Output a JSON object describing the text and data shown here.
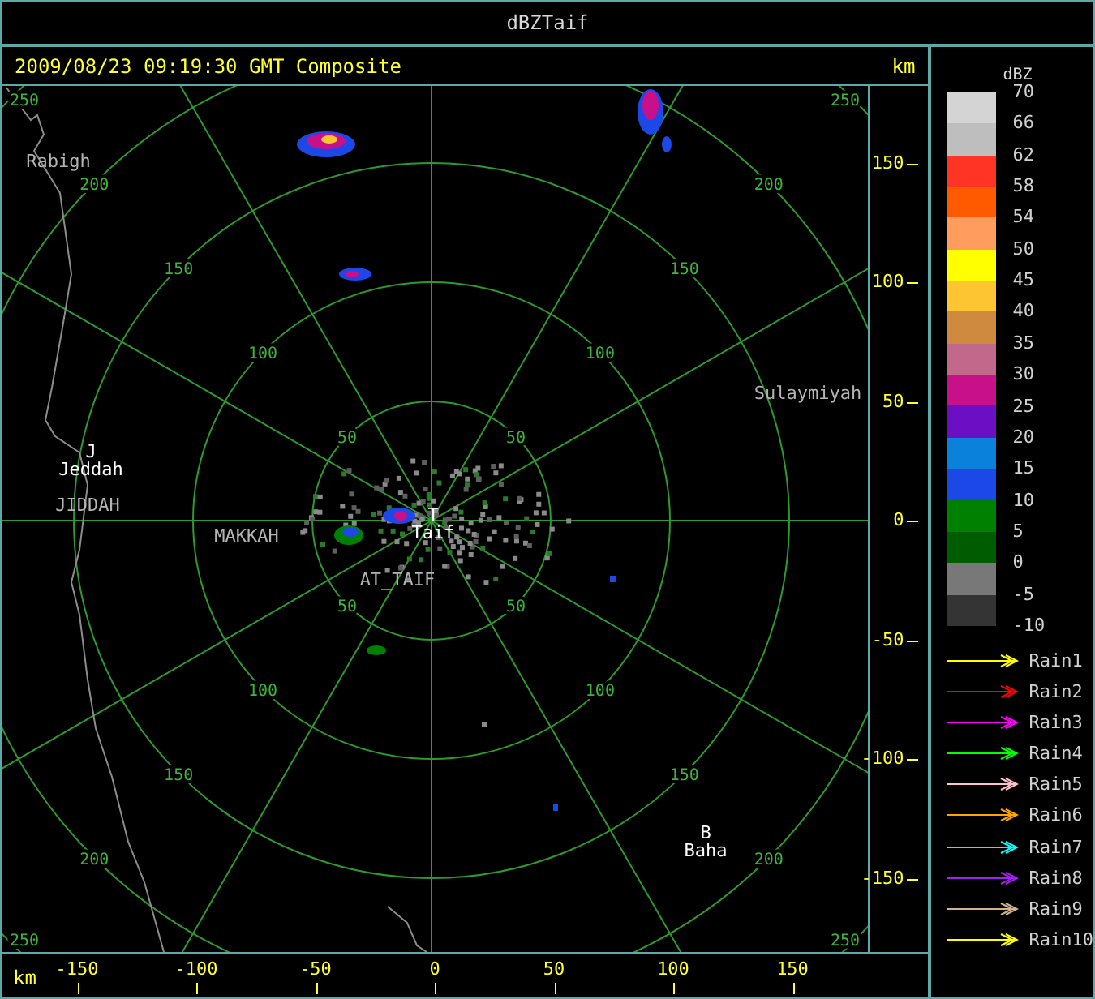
{
  "window": {
    "title": "dBZTaif"
  },
  "header": {
    "timestamp": "2009/08/23 09:19:30 GMT Composite",
    "unit": "km"
  },
  "map": {
    "range_rings": [
      {
        "labels": [
          "50",
          "50",
          "50",
          "50"
        ]
      },
      {
        "labels": [
          "100",
          "100",
          "100",
          "100"
        ]
      },
      {
        "labels": [
          "150",
          "150",
          "150",
          "150"
        ]
      },
      {
        "labels": [
          "200",
          "200",
          "200",
          "200"
        ]
      },
      {
        "labels": [
          "250",
          "250",
          "250",
          "250"
        ]
      }
    ],
    "places": [
      {
        "kind": "region",
        "label": "Rabigh"
      },
      {
        "kind": "station",
        "marker": "J",
        "label": "Jeddah"
      },
      {
        "kind": "region",
        "label": "JIDDAH"
      },
      {
        "kind": "region",
        "label": "MAKKAH"
      },
      {
        "kind": "station",
        "marker": "T",
        "label": "Taif"
      },
      {
        "kind": "region",
        "label": "AT_TAIF"
      },
      {
        "kind": "region",
        "label": "Sulaymiyah"
      },
      {
        "kind": "station",
        "marker": "B",
        "label": "Baha"
      }
    ]
  },
  "right_axis": {
    "ticks": [
      "150",
      "100",
      "50",
      "0",
      "-50",
      "-100",
      "-150"
    ]
  },
  "bottom_axis": {
    "unit": "km",
    "ticks": [
      "-150",
      "-100",
      "-50",
      "0",
      "50",
      "100",
      "150"
    ]
  },
  "legend": {
    "title": "dBZ",
    "labels": [
      "70",
      "66",
      "62",
      "58",
      "54",
      "50",
      "45",
      "40",
      "35",
      "30",
      "25",
      "20",
      "15",
      "10",
      "5",
      "0",
      "-5",
      "-10"
    ],
    "bands": [
      {
        "color": "#d4d4d4"
      },
      {
        "color": "#bebebe"
      },
      {
        "color": "#ff3424"
      },
      {
        "color": "#ff5a00"
      },
      {
        "color": "#ff9c5e"
      },
      {
        "color": "#ffff00"
      },
      {
        "color": "#fcc531"
      },
      {
        "color": "#d08a3f"
      },
      {
        "color": "#c2688b"
      },
      {
        "color": "#c8108a"
      },
      {
        "color": "#6c0ec4"
      },
      {
        "color": "#0a82dc"
      },
      {
        "color": "#1c48e8"
      },
      {
        "color": "#008000"
      },
      {
        "color": "#005c00"
      },
      {
        "color": "#787878"
      },
      {
        "color": "#343434"
      }
    ],
    "tracks": [
      {
        "label": "Rain1",
        "color": "#ffff00"
      },
      {
        "label": "Rain2",
        "color": "#ff0000"
      },
      {
        "label": "Rain3",
        "color": "#ff00ff"
      },
      {
        "label": "Rain4",
        "color": "#00ff00"
      },
      {
        "label": "Rain5",
        "color": "#ffc0cb"
      },
      {
        "label": "Rain6",
        "color": "#ffa500"
      },
      {
        "label": "Rain7",
        "color": "#00ffff"
      },
      {
        "label": "Rain8",
        "color": "#a020f0"
      },
      {
        "label": "Rain9",
        "color": "#d2b48c"
      },
      {
        "label": "Rain10",
        "color": "#ffff00"
      }
    ]
  }
}
